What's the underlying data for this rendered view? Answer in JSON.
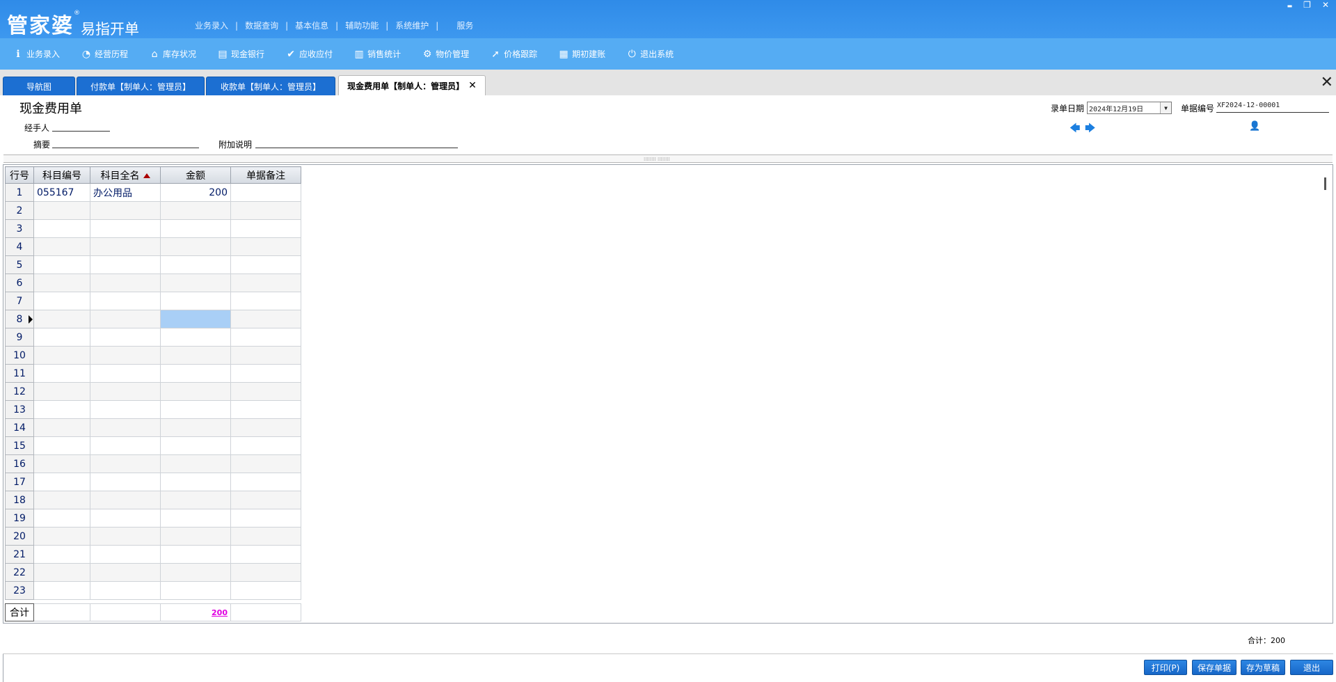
{
  "app": {
    "logo_main": "管家婆",
    "logo_reg": "®",
    "logo_sub": "易指开单",
    "top_menu": [
      "业务录入",
      "数据查询",
      "基本信息",
      "辅助功能",
      "系统维护",
      "服务"
    ],
    "top_menu_sep": "|",
    "window_controls": {
      "minimize": "▬",
      "restore": "❐",
      "close": "✕"
    }
  },
  "toolbar": [
    {
      "label": "业务录入",
      "icon": "edit-icon",
      "glyph": "ℹ"
    },
    {
      "label": "经营历程",
      "icon": "pie-chart-icon",
      "glyph": "◔"
    },
    {
      "label": "库存状况",
      "icon": "house-icon",
      "glyph": "⌂"
    },
    {
      "label": "现金银行",
      "icon": "book-icon",
      "glyph": "▤"
    },
    {
      "label": "应收应付",
      "icon": "check-circle-icon",
      "glyph": "✔"
    },
    {
      "label": "销售统计",
      "icon": "bar-chart-icon",
      "glyph": "▥"
    },
    {
      "label": "物价管理",
      "icon": "gear-icon",
      "glyph": "⚙"
    },
    {
      "label": "价格跟踪",
      "icon": "arrow-up-right-icon",
      "glyph": "➚"
    },
    {
      "label": "期初建账",
      "icon": "calculator-icon",
      "glyph": "▦"
    },
    {
      "label": "退出系统",
      "icon": "power-icon",
      "glyph": "⏻"
    }
  ],
  "tabs": [
    {
      "label": "导航图"
    },
    {
      "label": "付款单【制单人：管理员】"
    },
    {
      "label": "收款单【制单人：管理员】"
    },
    {
      "label": "现金费用单【制单人：管理员】",
      "close": "✕"
    }
  ],
  "strip_close": "✕",
  "form": {
    "title": "现金费用单",
    "handler_label": "经手人",
    "summary_label": "摘要",
    "extra_label": "附加说明",
    "date_label": "录单日期",
    "date_value": "2024年12月19日",
    "date_dropdown": "▼",
    "doc_no_label": "单据编号",
    "doc_no_value": "XF2024-12-00001",
    "prev_arrow": "🡄",
    "next_arrow": "🡆",
    "user_glyph": "👤"
  },
  "splitter_grip": "⁞⁞⁞⁞⁞⁞⁞⁞ ⁞⁞⁞⁞⁞⁞⁞⁞",
  "grid": {
    "columns": [
      "行号",
      "科目编号",
      "科目全名",
      "金额",
      "单据备注"
    ],
    "rows": [
      [
        "1",
        "055167",
        "办公用品",
        "200",
        ""
      ],
      [
        "2",
        "",
        "",
        "",
        ""
      ],
      [
        "3",
        "",
        "",
        "",
        ""
      ],
      [
        "4",
        "",
        "",
        "",
        ""
      ],
      [
        "5",
        "",
        "",
        "",
        ""
      ],
      [
        "6",
        "",
        "",
        "",
        ""
      ],
      [
        "7",
        "",
        "",
        "",
        ""
      ],
      [
        "8",
        "",
        "",
        "",
        ""
      ],
      [
        "9",
        "",
        "",
        "",
        ""
      ],
      [
        "10",
        "",
        "",
        "",
        ""
      ],
      [
        "11",
        "",
        "",
        "",
        ""
      ],
      [
        "12",
        "",
        "",
        "",
        ""
      ],
      [
        "13",
        "",
        "",
        "",
        ""
      ],
      [
        "14",
        "",
        "",
        "",
        ""
      ],
      [
        "15",
        "",
        "",
        "",
        ""
      ],
      [
        "16",
        "",
        "",
        "",
        ""
      ],
      [
        "17",
        "",
        "",
        "",
        ""
      ],
      [
        "18",
        "",
        "",
        "",
        ""
      ],
      [
        "19",
        "",
        "",
        "",
        ""
      ],
      [
        "20",
        "",
        "",
        "",
        ""
      ],
      [
        "21",
        "",
        "",
        "",
        ""
      ],
      [
        "22",
        "",
        "",
        "",
        ""
      ],
      [
        "23",
        "",
        "",
        "",
        ""
      ]
    ],
    "current_row": 8,
    "selected_col": 3,
    "totals_label": "合计",
    "totals_amount": "200"
  },
  "footer": {
    "total_text": "合计：200",
    "buttons": [
      "打印(P)",
      "保存单据",
      "存为草稿",
      "退出"
    ]
  }
}
